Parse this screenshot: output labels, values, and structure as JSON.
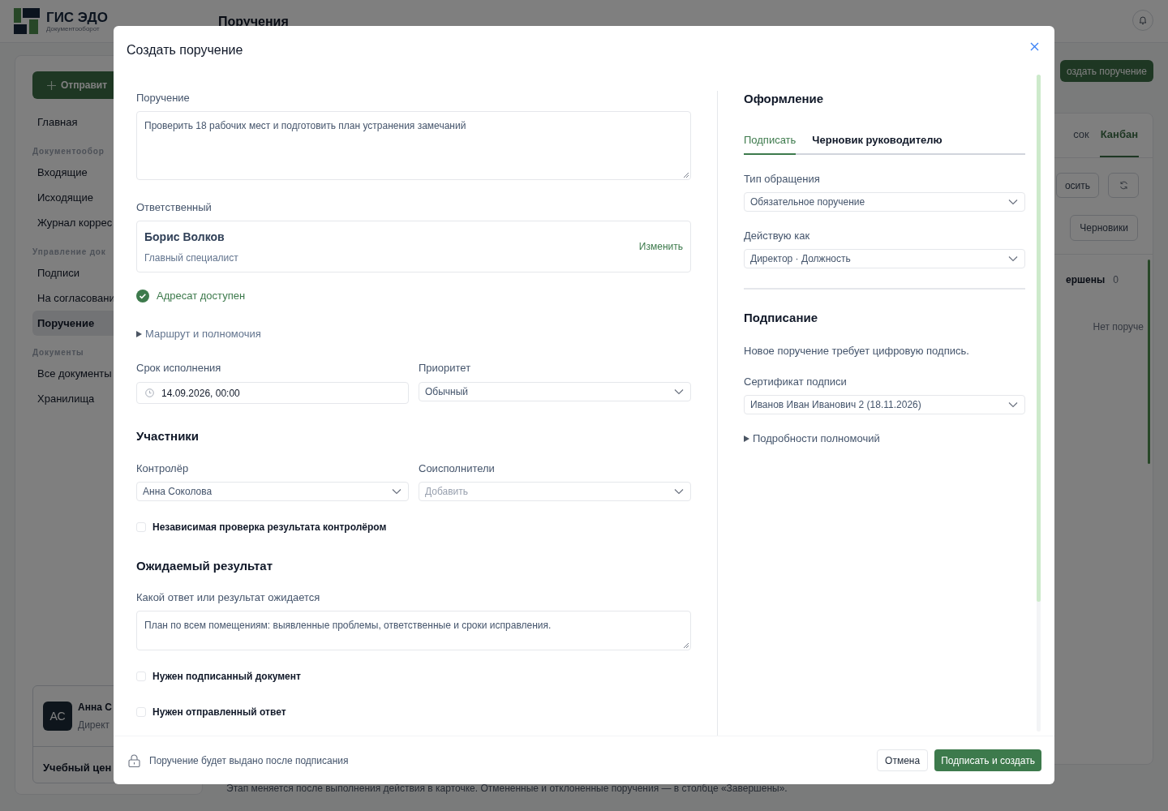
{
  "app": {
    "logo_title": "ГИС ЭДО",
    "logo_subtitle": "Документооборот",
    "page_title": "Поручения"
  },
  "sidebar": {
    "action_button": "Отправит",
    "items": [
      {
        "kind": "item",
        "label": "Главная",
        "selected": false
      },
      {
        "kind": "section",
        "label": "Документообор"
      },
      {
        "kind": "item",
        "label": "Входящие",
        "selected": false
      },
      {
        "kind": "item",
        "label": "Исходящие",
        "selected": false
      },
      {
        "kind": "item",
        "label": "Журнал коррес",
        "selected": false
      },
      {
        "kind": "section",
        "label": "Управление док"
      },
      {
        "kind": "item",
        "label": "Подписи",
        "selected": false
      },
      {
        "kind": "item",
        "label": "На согласовани",
        "selected": false
      },
      {
        "kind": "item",
        "label": "Поручение",
        "selected": true
      },
      {
        "kind": "section",
        "label": "Документы"
      },
      {
        "kind": "item",
        "label": "Все документы",
        "selected": false
      },
      {
        "kind": "item",
        "label": "Хранилища",
        "selected": false
      }
    ],
    "user_card": {
      "initials": "АС",
      "name": "Анна С",
      "role": "Директ",
      "organization": "Учебный цен"
    }
  },
  "main": {
    "create_button": "оздать поручение",
    "view_tabs": [
      {
        "label": "сок",
        "selected": false
      },
      {
        "label": "Канбан",
        "selected": true
      }
    ],
    "toolbar_button": "осить",
    "drafts_button": "Черновики",
    "column": {
      "title": "ершены",
      "count": "0",
      "empty_text": "Нет поруче"
    },
    "footnote": "Этап меняется после выполнения действия в карточке. Отмененные и отклоненные поручения — в столбце «Завершены»."
  },
  "dialog": {
    "title": "Создать поручение",
    "assignment": {
      "label": "Поручение",
      "value": "Проверить 18 рабочих мест и подготовить план устранения замечаний"
    },
    "responsible": {
      "label": "Ответственный",
      "name": "Борис Волков",
      "position": "Главный специалист",
      "change_link": "Изменить",
      "status": "Адресат доступен"
    },
    "route_toggle": {
      "label": "Маршрут и полномочия",
      "expanded": false
    },
    "deadline": {
      "label": "Срок исполнения",
      "value": "14.09.2026, 00:00"
    },
    "priority": {
      "label": "Приоритет",
      "value": "Обычный"
    },
    "participants": {
      "heading": "Участники",
      "controller": {
        "label": "Контролёр",
        "value": "Анна Соколова"
      },
      "coexecutors": {
        "label": "Соисполнители",
        "placeholder": "Добавить"
      },
      "independent_check": {
        "label": "Независимая проверка результата контролёром",
        "checked": false
      }
    },
    "expected_result": {
      "heading": "Ожидаемый результат",
      "label": "Какой ответ или результат ожидается",
      "value": "План по всем помещениям: выявленные проблемы, ответственные и сроки исправления.",
      "requirements": [
        {
          "label": "Нужен подписанный документ",
          "checked": false
        },
        {
          "label": "Нужен отправленный ответ",
          "checked": false
        }
      ]
    },
    "formatting": {
      "heading": "Оформление",
      "tabs": [
        {
          "label": "Подписать",
          "selected": true
        },
        {
          "label": "Черновик руководителю",
          "selected": false
        }
      ],
      "fields": [
        {
          "label": "Тип обращения",
          "value": "Обязательное поручение"
        },
        {
          "label": "Действую как",
          "value": "Директор · Должность"
        }
      ]
    },
    "signing": {
      "heading": "Подписание",
      "note": "Новое поручение требует цифровую подпись.",
      "certificate": {
        "label": "Сертификат подписи",
        "value": "Иванов Иван Иванович 2 (18.11.2026)"
      },
      "details_toggle": {
        "label": "Подробности полномочий",
        "expanded": false
      }
    },
    "footer": {
      "note": "Поручение будет выдано после подписания",
      "cancel": "Отмена",
      "submit": "Подписать и создать"
    }
  }
}
